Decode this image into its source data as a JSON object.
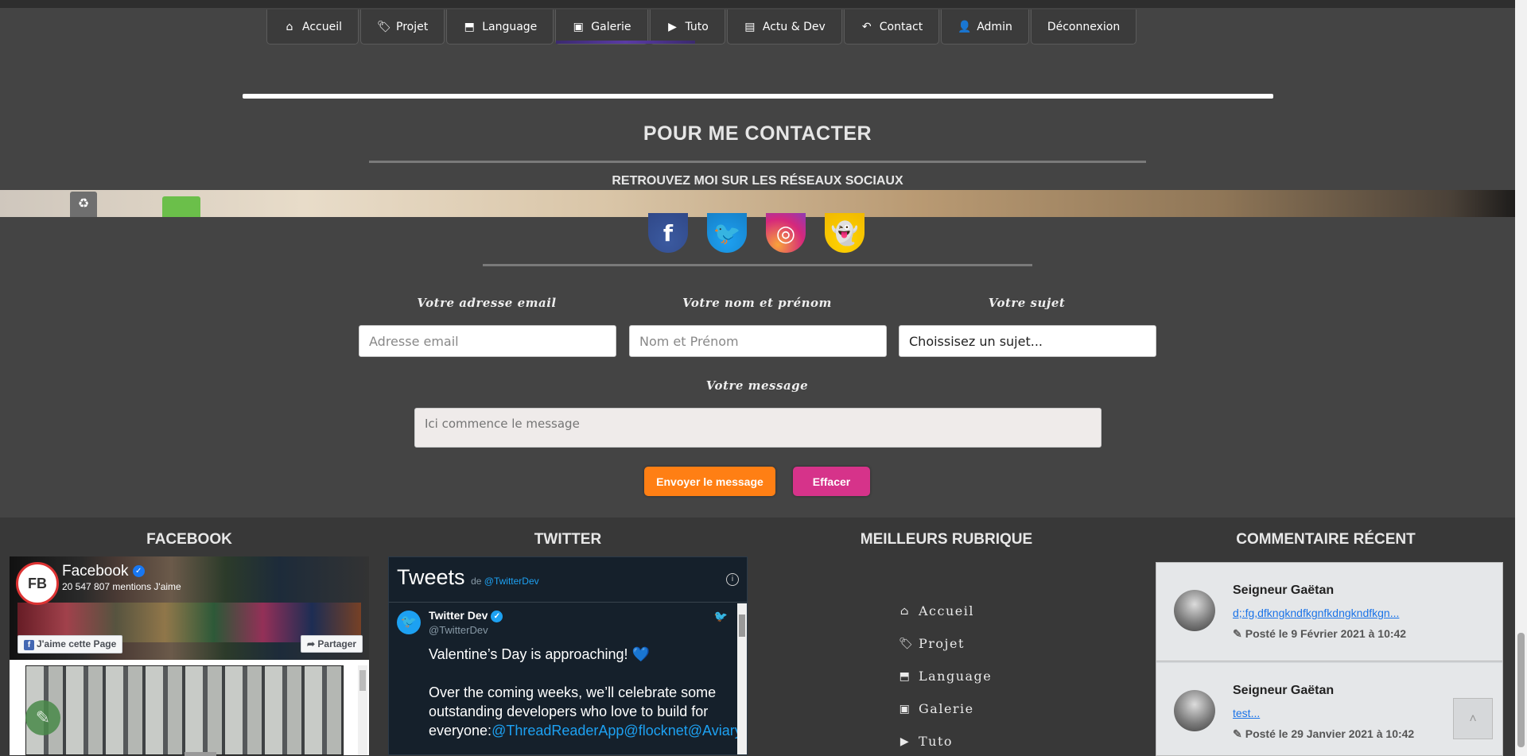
{
  "nav": {
    "items": [
      {
        "icon": "home-icon",
        "glyph": "⌂",
        "label": "Accueil"
      },
      {
        "icon": "tag-icon",
        "glyph": "🏷",
        "label": "Projet"
      },
      {
        "icon": "html5-icon",
        "glyph": "⬒",
        "label": "Language"
      },
      {
        "icon": "image-icon",
        "glyph": "▣",
        "label": "Galerie"
      },
      {
        "icon": "youtube-icon",
        "glyph": "▶",
        "label": "Tuto"
      },
      {
        "icon": "newspaper-icon",
        "glyph": "▤",
        "label": "Actu & Dev"
      },
      {
        "icon": "reply-icon",
        "glyph": "↶",
        "label": "Contact"
      },
      {
        "icon": "user-cog-icon",
        "glyph": "👤",
        "label": "Admin"
      },
      {
        "icon": "",
        "glyph": "",
        "label": "Déconnexion"
      }
    ]
  },
  "contact": {
    "title": "POUR ME CONTACTER",
    "social_title": "RETROUVEZ MOI SUR LES RÉSEAUX SOCIAUX",
    "socials": [
      {
        "name": "facebook",
        "glyph": "f"
      },
      {
        "name": "twitter",
        "glyph": "🐦"
      },
      {
        "name": "instagram",
        "glyph": "◎"
      },
      {
        "name": "snapchat",
        "glyph": "👻"
      }
    ]
  },
  "form": {
    "email_label": "Votre adresse email",
    "email_placeholder": "Adresse email",
    "name_label": "Votre nom et prénom",
    "name_placeholder": "Nom et Prénom",
    "subject_label": "Votre sujet",
    "subject_value": "Choissisez un sujet...",
    "message_label": "Votre message",
    "message_placeholder": "Ici commence le message",
    "send_label": "Envoyer le message",
    "clear_label": "Effacer"
  },
  "footer": {
    "facebook_title": "FACEBOOK",
    "twitter_title": "TWITTER",
    "rubriques_title": "MEILLEURS RUBRIQUE",
    "comments_title": "COMMENTAIRE RÉCENT",
    "fb": {
      "logo": "FB",
      "name": "Facebook",
      "likes": "20 547 807 mentions J'aime",
      "like_btn": "J'aime cette Page",
      "share_btn": "Partager"
    },
    "tw": {
      "header": "Tweets",
      "header_by": "de",
      "header_handle": "@TwitterDev",
      "author": "Twitter Dev",
      "handle": "@TwitterDev",
      "line1": "Valentine’s Day is approaching! 💙",
      "line2": "Over the coming weeks, we’ll celebrate some outstanding developers who love to build for everyone:",
      "links": "@ThreadReaderApp@flocknet@AviaryTheApp@ThreaderApp@firetalkteam"
    },
    "rubriques": [
      {
        "icon": "home-icon",
        "glyph": "⌂",
        "label": "Accueil"
      },
      {
        "icon": "tag-icon",
        "glyph": "🏷",
        "label": "Projet"
      },
      {
        "icon": "html5-icon",
        "glyph": "⬒",
        "label": "Language"
      },
      {
        "icon": "image-icon",
        "glyph": "▣",
        "label": "Galerie"
      },
      {
        "icon": "youtube-icon",
        "glyph": "▶",
        "label": "Tuto"
      }
    ],
    "comments": [
      {
        "author": "Seigneur Gaëtan",
        "text": "d;:fg,dfkngkndfkgnfkdngkndfkgn...",
        "date": "Posté le 9 Février 2021 à 10:42"
      },
      {
        "author": "Seigneur Gaëtan",
        "text": "test...",
        "date": "Posté le 29 Janvier 2021 à 10:42"
      }
    ]
  },
  "scroll_top_glyph": "˄"
}
